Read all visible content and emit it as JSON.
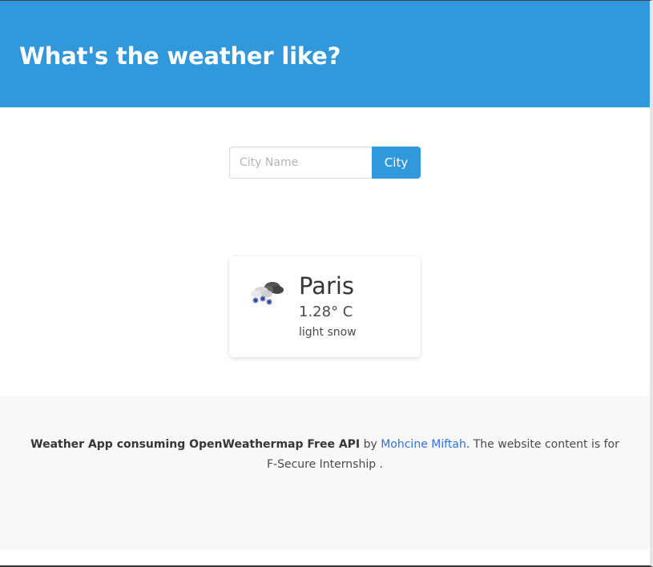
{
  "header": {
    "title": "What's the weather like?"
  },
  "search": {
    "placeholder": "City Name",
    "button_label": "City"
  },
  "weather_card": {
    "icon": "light-snow-icon",
    "city": "Paris",
    "temperature": "1.28° C",
    "description": "light snow"
  },
  "footer": {
    "app_name": "Weather App consuming OpenWeathermap Free API",
    "by_text": " by ",
    "author_link": "Mohcine Miftah",
    "suffix": ". The website content is for F-Secure Internship ."
  },
  "colors": {
    "primary": "#3298dc",
    "link": "#3273dc",
    "footer_bg": "#f8f8f8"
  }
}
